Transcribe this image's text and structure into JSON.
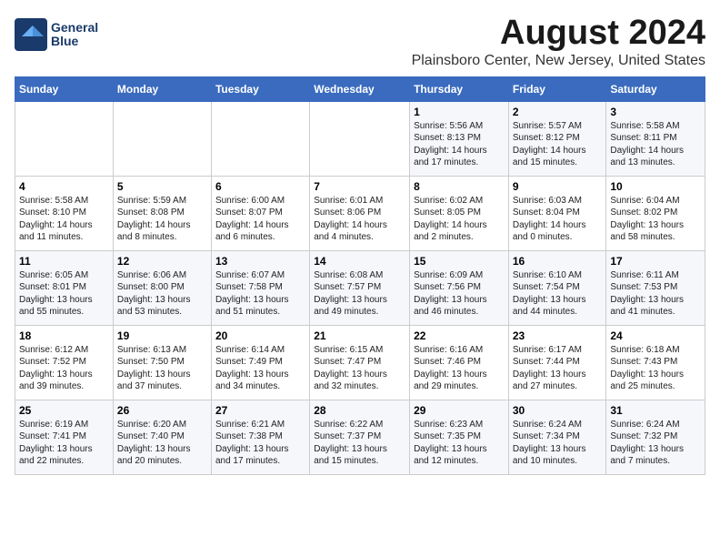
{
  "logo": {
    "line1": "General",
    "line2": "Blue"
  },
  "title": "August 2024",
  "subtitle": "Plainsboro Center, New Jersey, United States",
  "days_of_week": [
    "Sunday",
    "Monday",
    "Tuesday",
    "Wednesday",
    "Thursday",
    "Friday",
    "Saturday"
  ],
  "weeks": [
    [
      {
        "day": "",
        "info": ""
      },
      {
        "day": "",
        "info": ""
      },
      {
        "day": "",
        "info": ""
      },
      {
        "day": "",
        "info": ""
      },
      {
        "day": "1",
        "info": "Sunrise: 5:56 AM\nSunset: 8:13 PM\nDaylight: 14 hours\nand 17 minutes."
      },
      {
        "day": "2",
        "info": "Sunrise: 5:57 AM\nSunset: 8:12 PM\nDaylight: 14 hours\nand 15 minutes."
      },
      {
        "day": "3",
        "info": "Sunrise: 5:58 AM\nSunset: 8:11 PM\nDaylight: 14 hours\nand 13 minutes."
      }
    ],
    [
      {
        "day": "4",
        "info": "Sunrise: 5:58 AM\nSunset: 8:10 PM\nDaylight: 14 hours\nand 11 minutes."
      },
      {
        "day": "5",
        "info": "Sunrise: 5:59 AM\nSunset: 8:08 PM\nDaylight: 14 hours\nand 8 minutes."
      },
      {
        "day": "6",
        "info": "Sunrise: 6:00 AM\nSunset: 8:07 PM\nDaylight: 14 hours\nand 6 minutes."
      },
      {
        "day": "7",
        "info": "Sunrise: 6:01 AM\nSunset: 8:06 PM\nDaylight: 14 hours\nand 4 minutes."
      },
      {
        "day": "8",
        "info": "Sunrise: 6:02 AM\nSunset: 8:05 PM\nDaylight: 14 hours\nand 2 minutes."
      },
      {
        "day": "9",
        "info": "Sunrise: 6:03 AM\nSunset: 8:04 PM\nDaylight: 14 hours\nand 0 minutes."
      },
      {
        "day": "10",
        "info": "Sunrise: 6:04 AM\nSunset: 8:02 PM\nDaylight: 13 hours\nand 58 minutes."
      }
    ],
    [
      {
        "day": "11",
        "info": "Sunrise: 6:05 AM\nSunset: 8:01 PM\nDaylight: 13 hours\nand 55 minutes."
      },
      {
        "day": "12",
        "info": "Sunrise: 6:06 AM\nSunset: 8:00 PM\nDaylight: 13 hours\nand 53 minutes."
      },
      {
        "day": "13",
        "info": "Sunrise: 6:07 AM\nSunset: 7:58 PM\nDaylight: 13 hours\nand 51 minutes."
      },
      {
        "day": "14",
        "info": "Sunrise: 6:08 AM\nSunset: 7:57 PM\nDaylight: 13 hours\nand 49 minutes."
      },
      {
        "day": "15",
        "info": "Sunrise: 6:09 AM\nSunset: 7:56 PM\nDaylight: 13 hours\nand 46 minutes."
      },
      {
        "day": "16",
        "info": "Sunrise: 6:10 AM\nSunset: 7:54 PM\nDaylight: 13 hours\nand 44 minutes."
      },
      {
        "day": "17",
        "info": "Sunrise: 6:11 AM\nSunset: 7:53 PM\nDaylight: 13 hours\nand 41 minutes."
      }
    ],
    [
      {
        "day": "18",
        "info": "Sunrise: 6:12 AM\nSunset: 7:52 PM\nDaylight: 13 hours\nand 39 minutes."
      },
      {
        "day": "19",
        "info": "Sunrise: 6:13 AM\nSunset: 7:50 PM\nDaylight: 13 hours\nand 37 minutes."
      },
      {
        "day": "20",
        "info": "Sunrise: 6:14 AM\nSunset: 7:49 PM\nDaylight: 13 hours\nand 34 minutes."
      },
      {
        "day": "21",
        "info": "Sunrise: 6:15 AM\nSunset: 7:47 PM\nDaylight: 13 hours\nand 32 minutes."
      },
      {
        "day": "22",
        "info": "Sunrise: 6:16 AM\nSunset: 7:46 PM\nDaylight: 13 hours\nand 29 minutes."
      },
      {
        "day": "23",
        "info": "Sunrise: 6:17 AM\nSunset: 7:44 PM\nDaylight: 13 hours\nand 27 minutes."
      },
      {
        "day": "24",
        "info": "Sunrise: 6:18 AM\nSunset: 7:43 PM\nDaylight: 13 hours\nand 25 minutes."
      }
    ],
    [
      {
        "day": "25",
        "info": "Sunrise: 6:19 AM\nSunset: 7:41 PM\nDaylight: 13 hours\nand 22 minutes."
      },
      {
        "day": "26",
        "info": "Sunrise: 6:20 AM\nSunset: 7:40 PM\nDaylight: 13 hours\nand 20 minutes."
      },
      {
        "day": "27",
        "info": "Sunrise: 6:21 AM\nSunset: 7:38 PM\nDaylight: 13 hours\nand 17 minutes."
      },
      {
        "day": "28",
        "info": "Sunrise: 6:22 AM\nSunset: 7:37 PM\nDaylight: 13 hours\nand 15 minutes."
      },
      {
        "day": "29",
        "info": "Sunrise: 6:23 AM\nSunset: 7:35 PM\nDaylight: 13 hours\nand 12 minutes."
      },
      {
        "day": "30",
        "info": "Sunrise: 6:24 AM\nSunset: 7:34 PM\nDaylight: 13 hours\nand 10 minutes."
      },
      {
        "day": "31",
        "info": "Sunrise: 6:24 AM\nSunset: 7:32 PM\nDaylight: 13 hours\nand 7 minutes."
      }
    ]
  ]
}
